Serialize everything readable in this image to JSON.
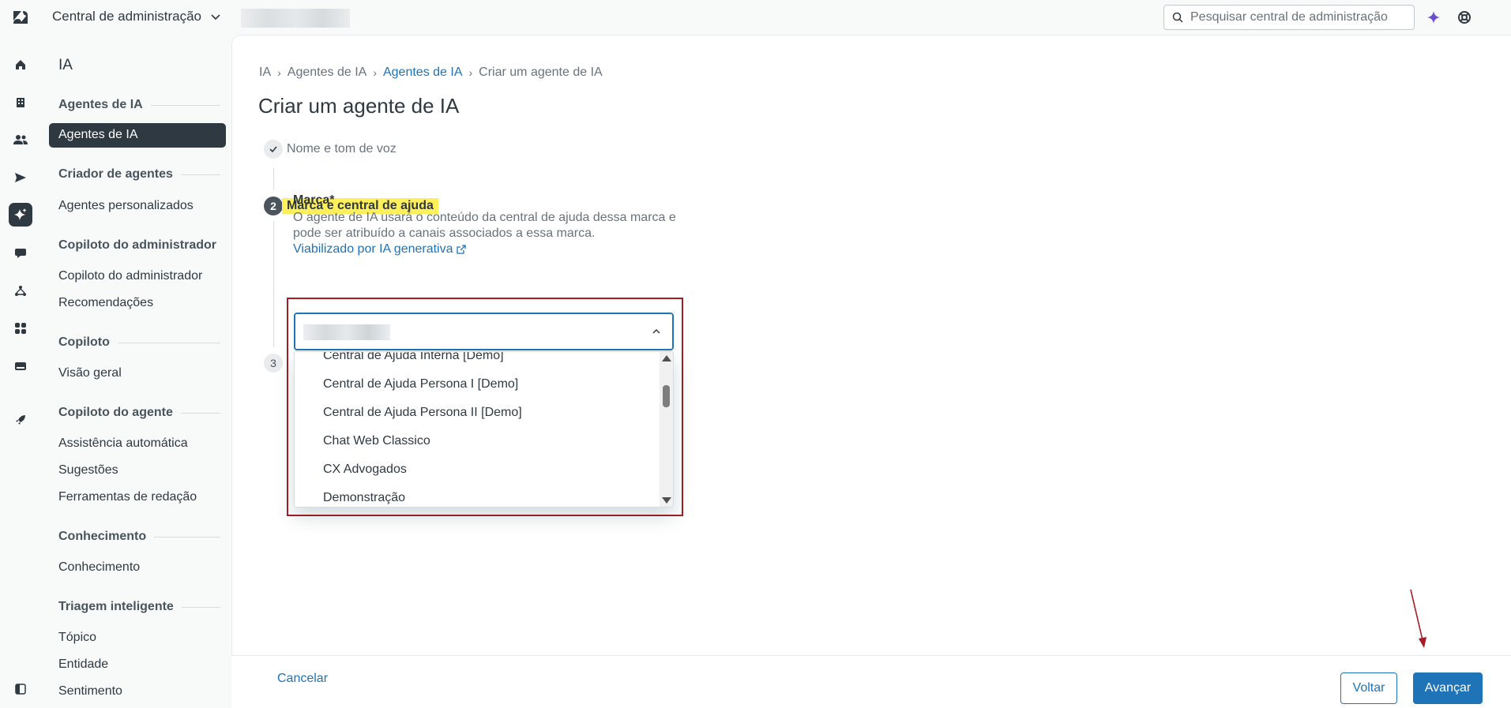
{
  "topbar": {
    "app_name": "Central de administração",
    "search_placeholder": "Pesquisar central de administração"
  },
  "subnav": {
    "title": "IA",
    "sections": [
      {
        "heading": "Agentes de IA",
        "items": [
          "Agentes de IA"
        ]
      },
      {
        "heading": "Criador de agentes",
        "items": [
          "Agentes personalizados"
        ]
      },
      {
        "heading": "Copiloto do administrador",
        "items": [
          "Copiloto do administrador",
          "Recomendações"
        ]
      },
      {
        "heading": "Copiloto",
        "items": [
          "Visão geral"
        ]
      },
      {
        "heading": "Copiloto do agente",
        "items": [
          "Assistência automática",
          "Sugestões",
          "Ferramentas de redação"
        ]
      },
      {
        "heading": "Conhecimento",
        "items": [
          "Conhecimento"
        ]
      },
      {
        "heading": "Triagem inteligente",
        "items": [
          "Tópico",
          "Entidade",
          "Sentimento"
        ]
      }
    ]
  },
  "breadcrumb": [
    "IA",
    "Agentes de IA",
    "Agentes de IA",
    "Criar um agente de IA"
  ],
  "page_title": "Criar um agente de IA",
  "steps": [
    {
      "label": "Nome e tom de voz",
      "state": "done"
    },
    {
      "number": "2",
      "label": "Marca e central de ajuda",
      "state": "active"
    },
    {
      "number": "3",
      "label": "",
      "state": "future"
    }
  ],
  "brand_field": {
    "label": "Marca*",
    "description": "O agente de IA usará o conteúdo da central de ajuda dessa marca e pode ser atribuído a canais associados a essa marca.",
    "link": "Viabilizado por IA generativa",
    "options": [
      "Central de Ajuda Interna [Demo]",
      "Central de Ajuda Persona I [Demo]",
      "Central de Ajuda Persona II [Demo]",
      "Chat Web Classico",
      "CX Advogados",
      "Demonstração"
    ]
  },
  "footer": {
    "cancel": "Cancelar",
    "back": "Voltar",
    "next": "Avançar"
  },
  "colors": {
    "accent": "#1f73b7",
    "highlight": "#ffef5a",
    "annotation": "#a51d24",
    "ai_sparkle": "#6a4ccf"
  }
}
